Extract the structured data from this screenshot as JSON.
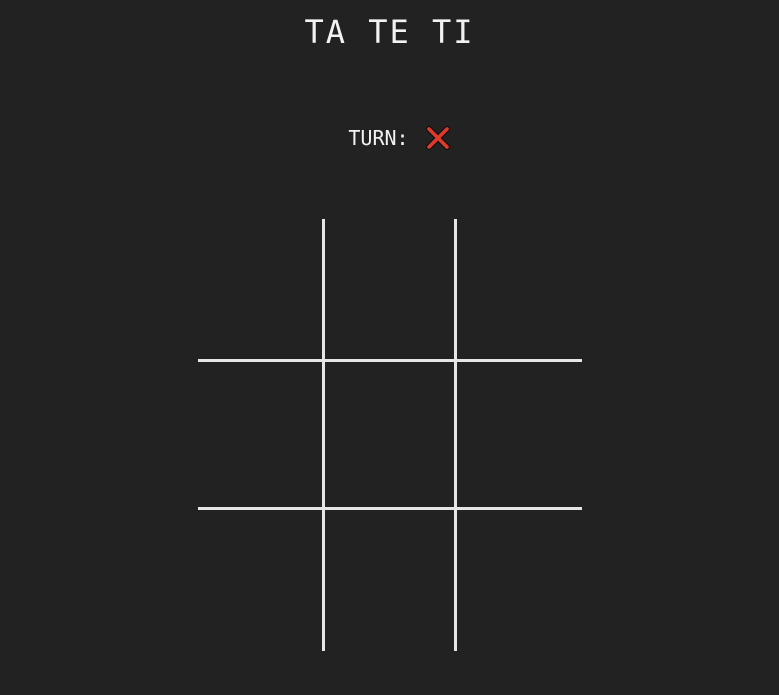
{
  "title": "TA TE TI",
  "turn": {
    "label": "TURN:",
    "current_player": "X",
    "icon": "x-mark-icon",
    "icon_color": "#e03a2a"
  },
  "board": {
    "cells": [
      "",
      "",
      "",
      "",
      "",
      "",
      "",
      "",
      ""
    ]
  },
  "colors": {
    "background": "#222222",
    "grid_lines": "#e6e6e6",
    "text": "#f2f2f2"
  }
}
